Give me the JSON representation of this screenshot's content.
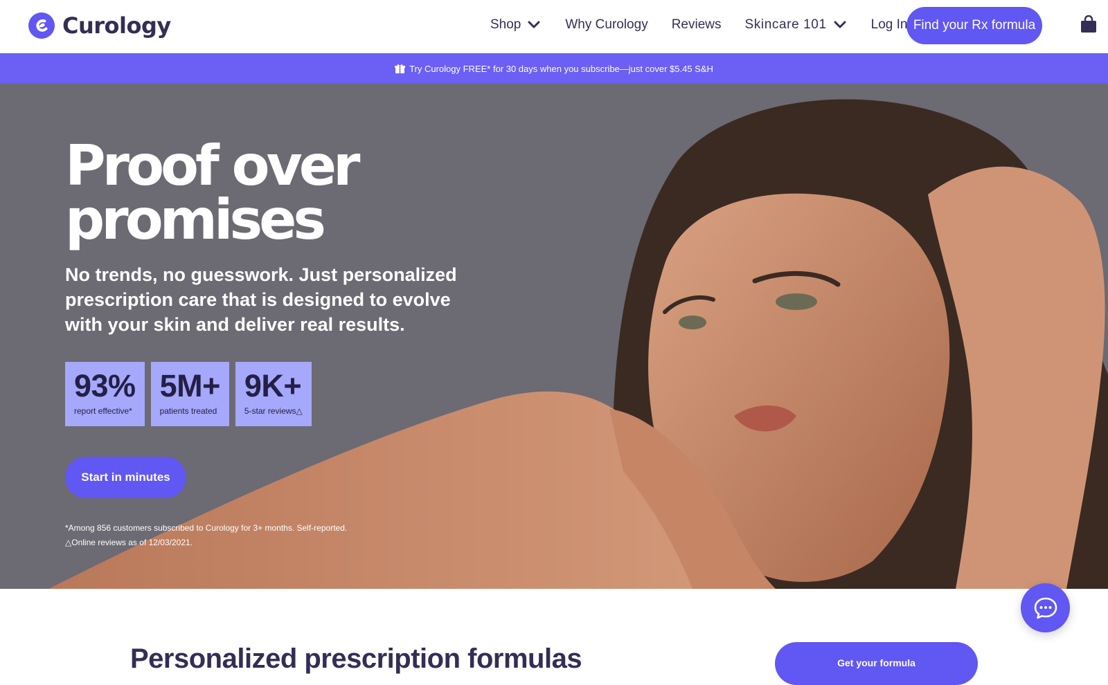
{
  "brand": {
    "name": "Curology",
    "logo_icon": "curology-logo-icon",
    "accent": "#6157f3",
    "banner_color": "#6b5ff4",
    "stat_color": "#a6a8fb"
  },
  "nav": {
    "shop": "Shop",
    "why": "Why Curology",
    "reviews": "Reviews",
    "skincare": "Skincare 101",
    "login": "Log In",
    "cta": "Find your Rx formula",
    "cart_icon": "shopping-bag-icon"
  },
  "promo": {
    "icon": "gift-icon",
    "text": "Try Curology FREE* for 30 days when you subscribe—just cover $5.45 S&H"
  },
  "hero": {
    "title_line1": "Proof over",
    "title_line2": "promises",
    "subtitle": "No trends, no guesswork. Just personalized prescription care that is designed to evolve with your skin and deliver real results.",
    "stats": [
      {
        "value": "93%",
        "label": "report effective*"
      },
      {
        "value": "5M+",
        "label": "patients treated"
      },
      {
        "value": "9K+",
        "label": "5-star reviews△"
      }
    ],
    "cta": "Start in minutes",
    "footnote1": "*Among 856 customers subscribed to Curology for 3+ months. Self-reported.",
    "footnote2": "△Online reviews as of 12/03/2021."
  },
  "chat": {
    "icon": "chat-bubble-icon"
  },
  "section": {
    "title": "Personalized prescription formulas",
    "cta": "Get your formula"
  }
}
